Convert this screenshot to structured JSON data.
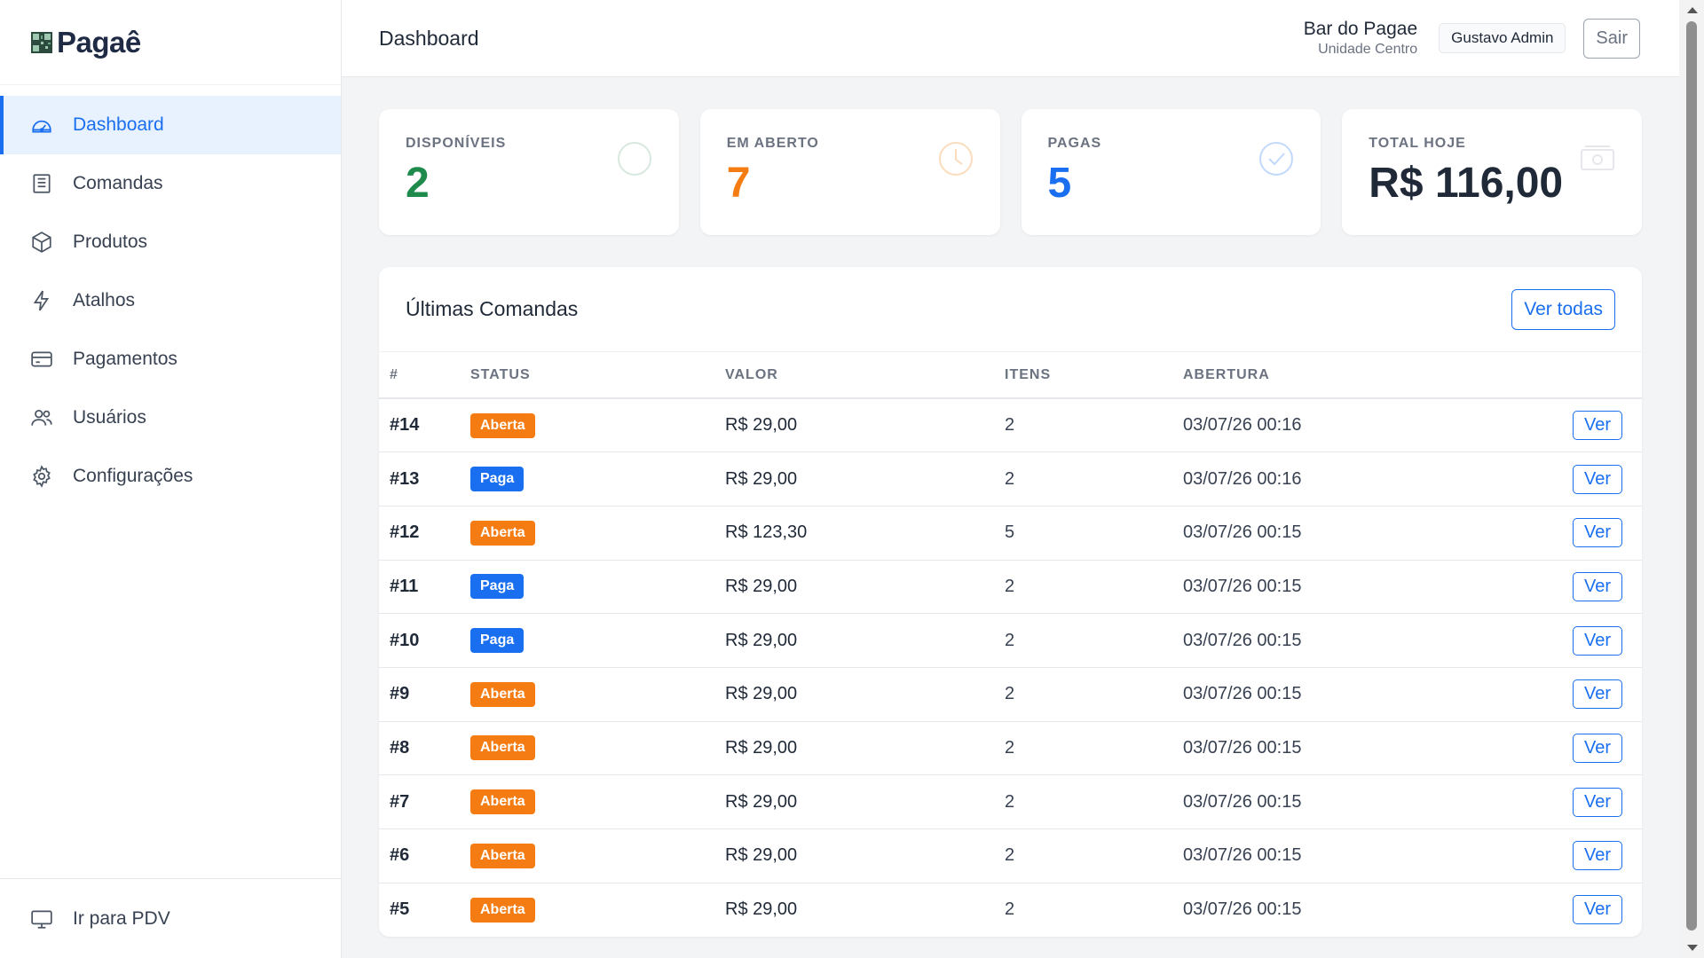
{
  "brand": {
    "name": "Pagaê"
  },
  "sidebar": {
    "items": [
      {
        "label": "Dashboard",
        "icon": "gauge-icon",
        "active": true
      },
      {
        "label": "Comandas",
        "icon": "receipt-icon",
        "active": false
      },
      {
        "label": "Produtos",
        "icon": "box-icon",
        "active": false
      },
      {
        "label": "Atalhos",
        "icon": "lightning-icon",
        "active": false
      },
      {
        "label": "Pagamentos",
        "icon": "credit-card-icon",
        "active": false
      },
      {
        "label": "Usuários",
        "icon": "users-icon",
        "active": false
      },
      {
        "label": "Configurações",
        "icon": "gear-icon",
        "active": false
      }
    ],
    "footer": {
      "label": "Ir para PDV",
      "icon": "monitor-icon"
    }
  },
  "header": {
    "title": "Dashboard",
    "unit_name": "Bar do Pagae",
    "unit_sub": "Unidade Centro",
    "user": "Gustavo Admin",
    "logout": "Sair"
  },
  "stats": [
    {
      "label": "DISPONÍVEIS",
      "value": "2",
      "color": "#1e8a4c",
      "icon": "circle-icon"
    },
    {
      "label": "EM ABERTO",
      "value": "7",
      "color": "#f57c12",
      "icon": "clock-icon"
    },
    {
      "label": "PAGAS",
      "value": "5",
      "color": "#1a6ff0",
      "icon": "check-circle-icon"
    },
    {
      "label": "TOTAL HOJE",
      "value": "R$ 116,00",
      "color": "#1f2937",
      "icon": "cash-icon"
    }
  ],
  "recent": {
    "title": "Últimas Comandas",
    "view_all": "Ver todas",
    "columns": [
      "#",
      "STATUS",
      "VALOR",
      "ITENS",
      "ABERTURA"
    ],
    "rows": [
      {
        "num": "#14",
        "status": "Aberta",
        "valor": "R$ 29,00",
        "itens": "2",
        "abertura": "03/07/26 00:16",
        "action": "Ver"
      },
      {
        "num": "#13",
        "status": "Paga",
        "valor": "R$ 29,00",
        "itens": "2",
        "abertura": "03/07/26 00:16",
        "action": "Ver"
      },
      {
        "num": "#12",
        "status": "Aberta",
        "valor": "R$ 123,30",
        "itens": "5",
        "abertura": "03/07/26 00:15",
        "action": "Ver"
      },
      {
        "num": "#11",
        "status": "Paga",
        "valor": "R$ 29,00",
        "itens": "2",
        "abertura": "03/07/26 00:15",
        "action": "Ver"
      },
      {
        "num": "#10",
        "status": "Paga",
        "valor": "R$ 29,00",
        "itens": "2",
        "abertura": "03/07/26 00:15",
        "action": "Ver"
      },
      {
        "num": "#9",
        "status": "Aberta",
        "valor": "R$ 29,00",
        "itens": "2",
        "abertura": "03/07/26 00:15",
        "action": "Ver"
      },
      {
        "num": "#8",
        "status": "Aberta",
        "valor": "R$ 29,00",
        "itens": "2",
        "abertura": "03/07/26 00:15",
        "action": "Ver"
      },
      {
        "num": "#7",
        "status": "Aberta",
        "valor": "R$ 29,00",
        "itens": "2",
        "abertura": "03/07/26 00:15",
        "action": "Ver"
      },
      {
        "num": "#6",
        "status": "Aberta",
        "valor": "R$ 29,00",
        "itens": "2",
        "abertura": "03/07/26 00:15",
        "action": "Ver"
      },
      {
        "num": "#5",
        "status": "Aberta",
        "valor": "R$ 29,00",
        "itens": "2",
        "abertura": "03/07/26 00:15",
        "action": "Ver"
      }
    ]
  },
  "status_colors": {
    "Aberta": "#f57c12",
    "Paga": "#1a6ff0"
  }
}
